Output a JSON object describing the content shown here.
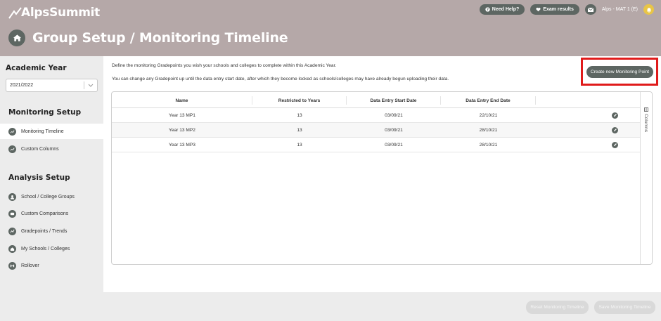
{
  "header": {
    "logo_text": "AlpsSummit",
    "help_label": "Need Help?",
    "exam_label": "Exam results",
    "user_label": "Alps - MAT 1 (E)",
    "page_title": "Group Setup / Monitoring Timeline"
  },
  "sidebar": {
    "academic_year_heading": "Academic Year",
    "year_value": "2021/2022",
    "monitoring_heading": "Monitoring Setup",
    "monitoring_items": [
      {
        "label": "Monitoring Timeline",
        "active": true
      },
      {
        "label": "Custom Columns",
        "active": false
      }
    ],
    "analysis_heading": "Analysis Setup",
    "analysis_items": [
      {
        "label": "School / College Groups"
      },
      {
        "label": "Custom Comparisons"
      },
      {
        "label": "Gradepoints / Trends"
      },
      {
        "label": "My Schools / Colleges"
      },
      {
        "label": "Rollover"
      }
    ]
  },
  "main": {
    "desc1": "Define the monitoring Gradepoints you wish your schools and colleges to complete within this Academic Year.",
    "desc2": "You can change any Gradepoint up until the data entry start date, after which they become locked as schools/colleges may have already begun uploading their data.",
    "create_button": "Create new Monitoring Point",
    "columns_label": "Columns"
  },
  "table": {
    "headers": [
      "Name",
      "Restricted to Years",
      "Data Entry Start Date",
      "Data Entry End Date",
      ""
    ],
    "rows": [
      [
        "Year 13 MP1",
        "13",
        "03/09/21",
        "22/10/21"
      ],
      [
        "Year 13 MP2",
        "13",
        "03/09/21",
        "28/10/21"
      ],
      [
        "Year 13 MP3",
        "13",
        "03/09/21",
        "28/10/21"
      ]
    ]
  },
  "footer": {
    "reset_label": "Reset Monitoring Timeline",
    "save_label": "Save Monitoring Timeline"
  },
  "colors": {
    "header_bg": "#b5a8a8",
    "button_dark": "#5d6662",
    "highlight": "#e01b1b",
    "user_badge": "#e8c547"
  }
}
